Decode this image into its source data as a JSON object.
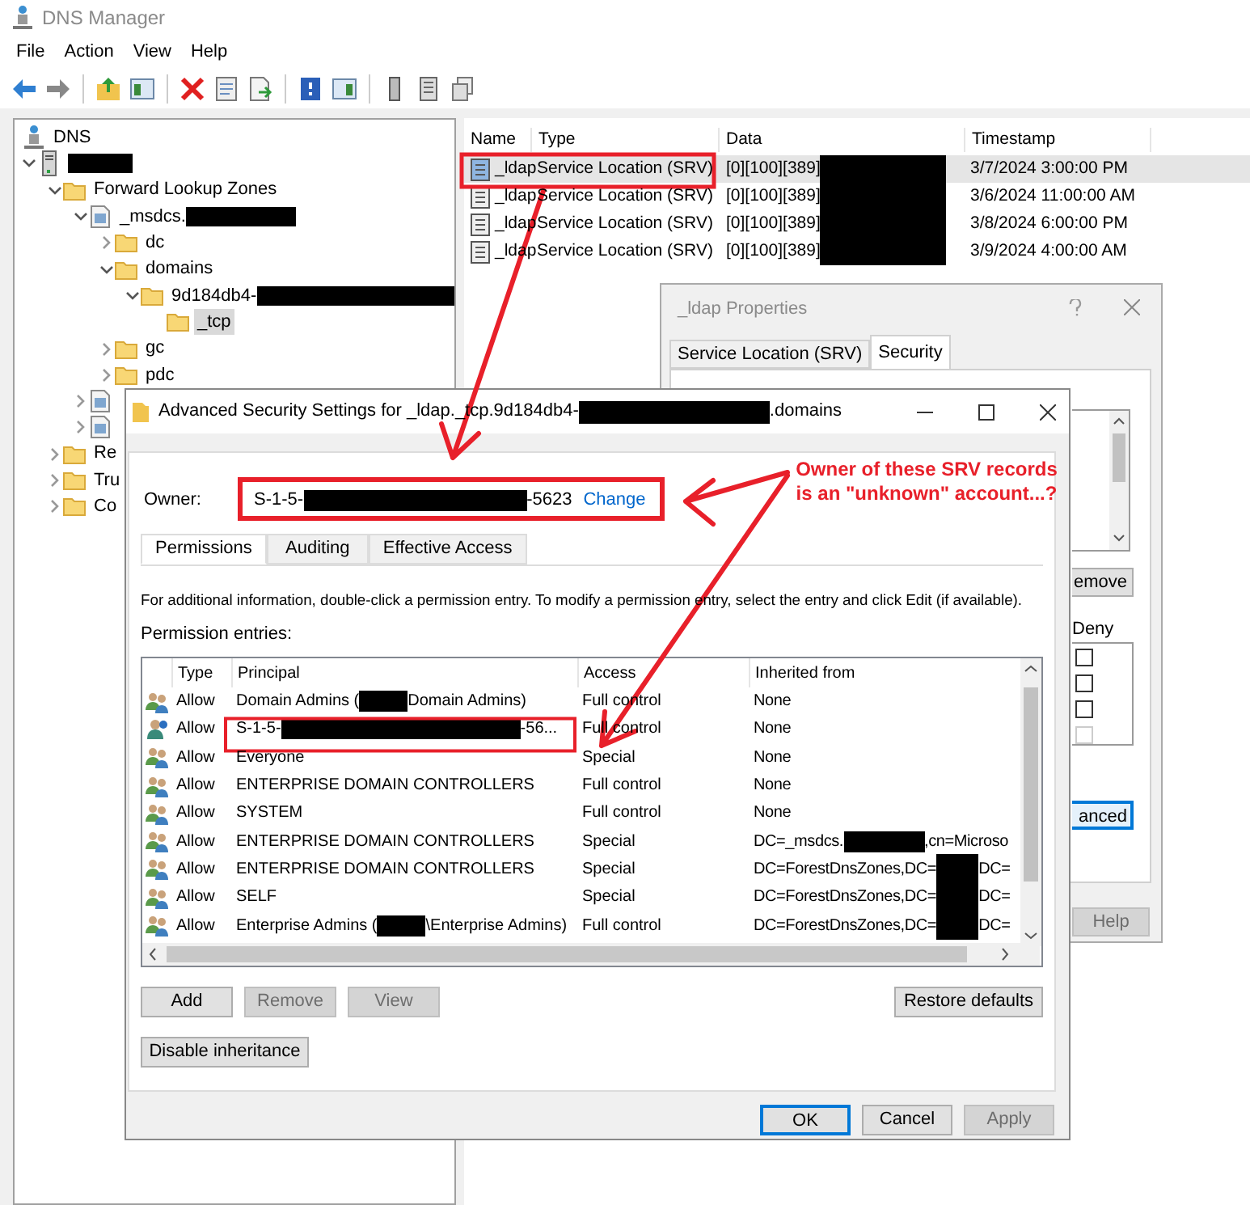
{
  "window": {
    "title": "DNS Manager"
  },
  "menu": [
    "File",
    "Action",
    "View",
    "Help"
  ],
  "tree": [
    {
      "label": "DNS",
      "selected": false,
      "children": [
        {
          "redacted": true,
          "expanded": true,
          "selected": false,
          "children": [
            {
              "label": "Forward Lookup Zones",
              "expanded": true,
              "selected": false,
              "children": [
                {
                  "label": "_msdcs.",
                  "redacted": true,
                  "expanded": true,
                  "selected": false,
                  "children": [
                    {
                      "label": "dc",
                      "expanded": false,
                      "selected": false
                    },
                    {
                      "label": "domains",
                      "expanded": true,
                      "selected": false,
                      "children": [
                        {
                          "label": "9d184db4-",
                          "redacted": true,
                          "expanded": true,
                          "selected": false,
                          "children": [
                            {
                              "label": "_tcp",
                              "selected": true
                            }
                          ]
                        }
                      ]
                    },
                    {
                      "label": "gc",
                      "expanded": false,
                      "selected": false
                    },
                    {
                      "label": "pdc",
                      "expanded": false,
                      "selected": false
                    }
                  ]
                },
                {
                  "expanded": false,
                  "selected": false
                },
                {
                  "expanded": false,
                  "selected": false
                }
              ]
            },
            {
              "label": "Re",
              "expanded": false,
              "selected": false
            },
            {
              "label": "Tru",
              "expanded": false,
              "selected": false
            },
            {
              "label": "Co",
              "expanded": false,
              "selected": false
            }
          ]
        }
      ]
    }
  ],
  "records": {
    "columns": [
      "Name",
      "Type",
      "Data",
      "Timestamp"
    ],
    "rows": [
      {
        "name": "_ldap",
        "type": "Service Location (SRV)",
        "data": "[0][100][389]",
        "data_redacted": true,
        "timestamp": "3/7/2024 3:00:00 PM",
        "selected": true
      },
      {
        "name": "_ldap",
        "type": "Service Location (SRV)",
        "data": "[0][100][389]",
        "data_redacted": true,
        "timestamp": "3/6/2024 11:00:00 AM",
        "selected": false
      },
      {
        "name": "_ldap",
        "type": "Service Location (SRV)",
        "data": "[0][100][389]",
        "data_redacted": true,
        "timestamp": "3/8/2024 6:00:00 PM",
        "selected": false
      },
      {
        "name": "_ldap",
        "type": "Service Location (SRV)",
        "data": "[0][100][389]",
        "data_redacted": true,
        "timestamp": "3/9/2024 4:00:00 AM",
        "selected": false
      }
    ]
  },
  "properties": {
    "title": "_ldap Properties",
    "tabs": [
      {
        "label": "Service Location (SRV)",
        "selected": false
      },
      {
        "label": "Security",
        "selected": true
      }
    ],
    "remove_button": "emove",
    "deny_label": "Deny",
    "deny_checks": [
      {
        "checked": false,
        "disabled": false
      },
      {
        "checked": false,
        "disabled": false
      },
      {
        "checked": false,
        "disabled": false
      },
      {
        "checked": false,
        "disabled": true
      }
    ],
    "advanced_button": "anced",
    "help_button": {
      "label": "Help",
      "disabled": true
    }
  },
  "advanced": {
    "title": [
      "Advanced Security Settings for _ldap._tcp.9d184db4-",
      ".domains"
    ],
    "title_redacted": true,
    "owner_label": "Owner:",
    "owner": [
      "S-1-5-",
      "-5623"
    ],
    "owner_redacted": true,
    "change_link": "Change",
    "tabs": [
      {
        "label": "Permissions",
        "selected": true
      },
      {
        "label": "Auditing",
        "selected": false
      },
      {
        "label": "Effective Access",
        "selected": false
      }
    ],
    "info": "For additional information, double-click a permission entry. To modify a permission entry, select the entry and click Edit (if available).",
    "entries_label": "Permission entries:",
    "columns": [
      "Type",
      "Principal",
      "Access",
      "Inherited from"
    ],
    "entries": [
      {
        "kind": "group",
        "type": "Allow",
        "principal": [
          "Domain Admins (",
          "Domain Admins)"
        ],
        "principal_redacted": true,
        "access": "Full control",
        "inherited": [
          "None"
        ],
        "selected": false
      },
      {
        "kind": "unknown",
        "type": "Allow",
        "principal": [
          "S-1-5-",
          "-56..."
        ],
        "principal_redacted": true,
        "access": "Full control",
        "inherited": [
          "None"
        ],
        "selected": false
      },
      {
        "kind": "group",
        "type": "Allow",
        "principal": [
          "Everyone"
        ],
        "access": "Special",
        "inherited": [
          "None"
        ],
        "selected": false
      },
      {
        "kind": "group",
        "type": "Allow",
        "principal": [
          "ENTERPRISE DOMAIN CONTROLLERS"
        ],
        "access": "Full control",
        "inherited": [
          "None"
        ],
        "selected": false
      },
      {
        "kind": "group",
        "type": "Allow",
        "principal": [
          "SYSTEM"
        ],
        "access": "Full control",
        "inherited": [
          "None"
        ],
        "selected": false
      },
      {
        "kind": "group",
        "type": "Allow",
        "principal": [
          "ENTERPRISE DOMAIN CONTROLLERS"
        ],
        "access": "Special",
        "inherited": [
          "DC=_msdcs.",
          ",cn=Microso"
        ],
        "inherited_redacted": true,
        "selected": false
      },
      {
        "kind": "group",
        "type": "Allow",
        "principal": [
          "ENTERPRISE DOMAIN CONTROLLERS"
        ],
        "access": "Special",
        "inherited": [
          "DC=ForestDnsZones,DC=",
          "DC="
        ],
        "inherited_redacted": true,
        "selected": false
      },
      {
        "kind": "group",
        "type": "Allow",
        "principal": [
          "SELF"
        ],
        "access": "Special",
        "inherited": [
          "DC=ForestDnsZones,DC=",
          "DC="
        ],
        "inherited_redacted": true,
        "selected": false
      },
      {
        "kind": "group",
        "type": "Allow",
        "principal": [
          "Enterprise Admins (",
          "\\Enterprise Admins)"
        ],
        "principal_redacted": true,
        "access": "Full control",
        "inherited": [
          "DC=ForestDnsZones,DC=",
          "DC="
        ],
        "inherited_redacted": true,
        "selected": false
      }
    ],
    "buttons": [
      {
        "label": "Add",
        "disabled": false
      },
      {
        "label": "Remove",
        "disabled": true
      },
      {
        "label": "View",
        "disabled": true
      }
    ],
    "restore_button": "Restore defaults",
    "inheritance_button": "Disable inheritance",
    "footer_buttons": [
      {
        "label": "OK",
        "disabled": false,
        "default": true
      },
      {
        "label": "Cancel",
        "disabled": false,
        "default": false
      },
      {
        "label": "Apply",
        "disabled": true,
        "default": false
      }
    ]
  },
  "annotation": {
    "note": "Owner of these SRV records is an \"unknown\" account...?"
  }
}
